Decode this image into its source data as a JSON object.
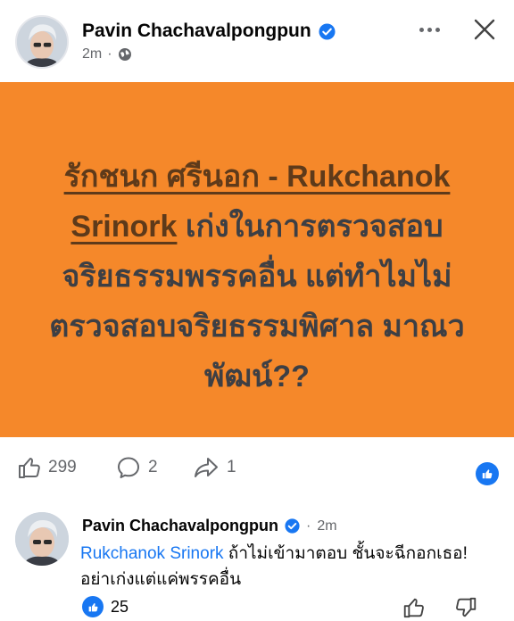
{
  "post": {
    "author": "Pavin Chachavalpongpun",
    "time": "2m",
    "separator": "·",
    "image_text": {
      "line1_a": "รักชนก ศรีนอก - Rukchanok",
      "line2_a": "Srinork",
      "line2_b": " เก่งในการตรวจสอบ",
      "line3": "จริยธรรมพรรคอื่น แต่ทำไมไม่",
      "line4": "ตรวจสอบจริยธรรมพิศาล มาณว",
      "line5": "พัฒน์??"
    },
    "background_color": "#f5882a"
  },
  "actions": {
    "likes": "299",
    "comments": "2",
    "shares": "1"
  },
  "comment": {
    "author": "Pavin Chachavalpongpun",
    "separator": "·",
    "time": "2m",
    "mention": "Rukchanok Srinork",
    "text": " ถ้าไม่เข้ามาตอบ ชั้นจะฉีกอกเธอ! อย่าเก่งแต่แค่พรรคอื่น",
    "reactions": "25"
  },
  "icons": {
    "verified": "verified-badge-icon",
    "privacy": "globe-icon",
    "more": "more-options-icon",
    "close": "close-icon",
    "like": "thumbs-up-icon",
    "comment": "comment-bubble-icon",
    "share": "share-arrow-icon",
    "dislike": "thumbs-down-icon"
  },
  "colors": {
    "accent": "#1877f2",
    "secondary_text": "#65676b"
  }
}
